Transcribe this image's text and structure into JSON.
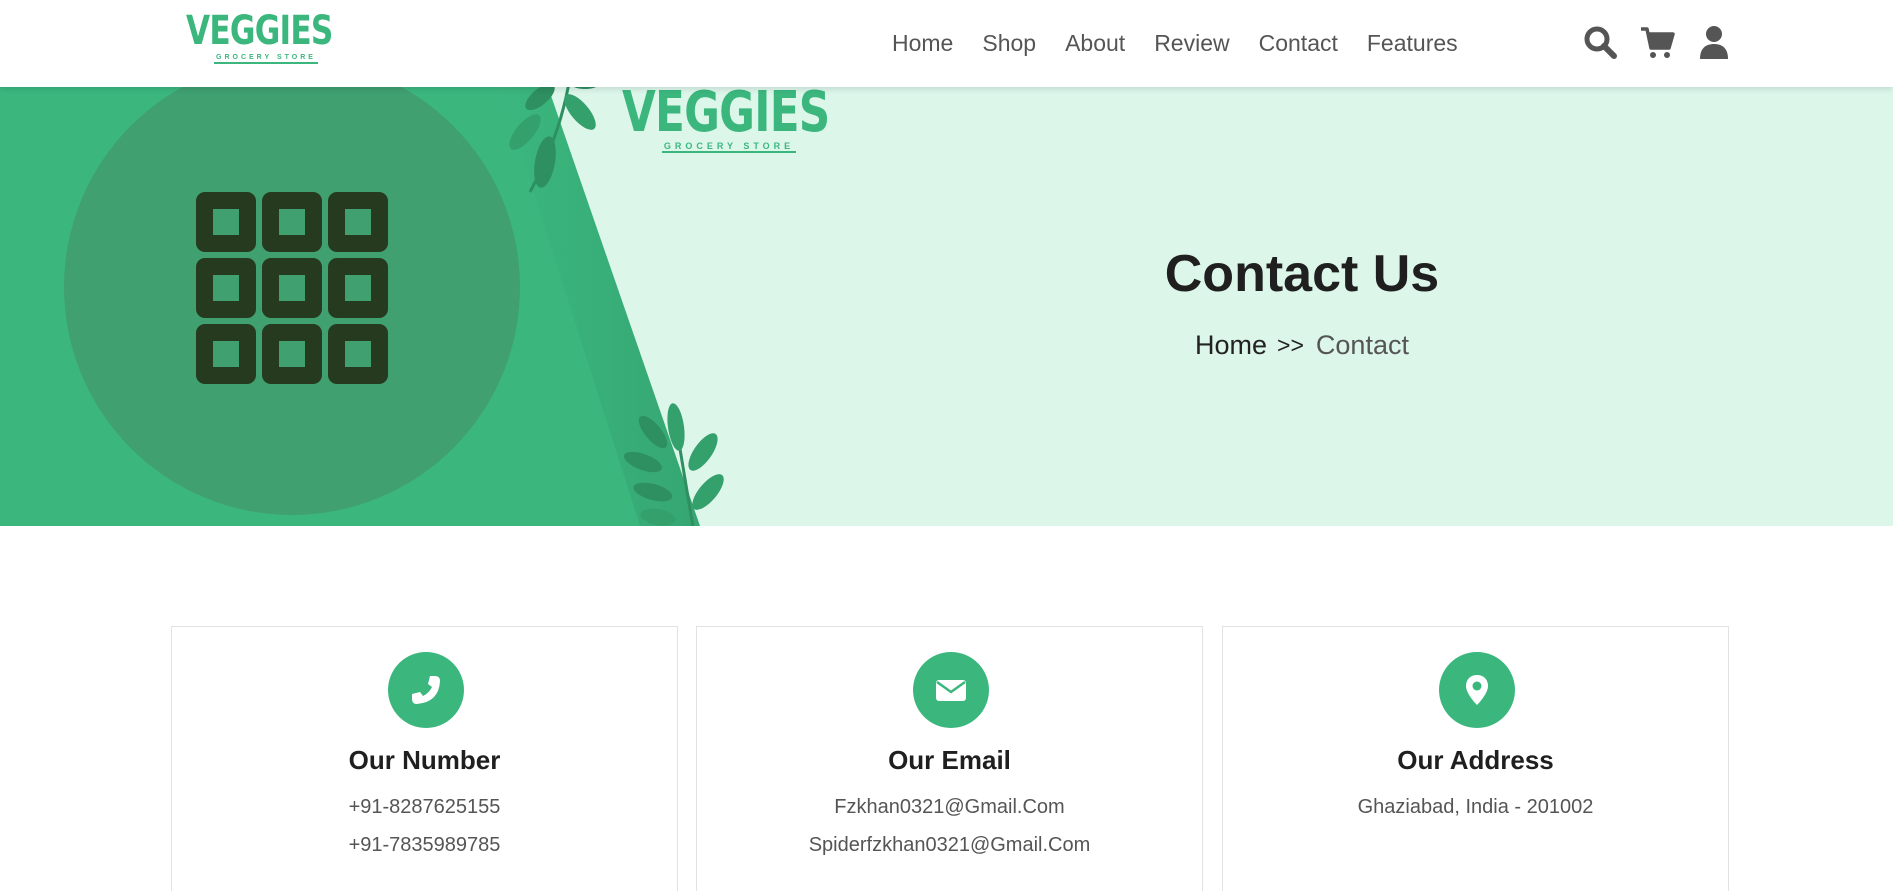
{
  "brand": {
    "name": "VEGGIES",
    "tagline": "GROCERY STORE",
    "accent_color": "#3bb77e",
    "banner_bg_color": "#dcf6ea"
  },
  "nav": {
    "items": [
      {
        "label": "Home"
      },
      {
        "label": "Shop"
      },
      {
        "label": "About"
      },
      {
        "label": "Review"
      },
      {
        "label": "Contact"
      },
      {
        "label": "Features"
      }
    ]
  },
  "header_icons": [
    "search-icon",
    "cart-icon",
    "user-icon"
  ],
  "banner": {
    "title": "Contact Us",
    "breadcrumb": {
      "home": "Home",
      "separator": ">>",
      "current": "Contact"
    },
    "illustration_icon": "grid-icon"
  },
  "contact_cards": [
    {
      "icon": "phone-icon",
      "title": "Our Number",
      "lines": [
        "+91-8287625155",
        "+91-7835989785"
      ]
    },
    {
      "icon": "envelope-icon",
      "title": "Our Email",
      "lines": [
        "Fzkhan0321@Gmail.Com",
        "Spiderfzkhan0321@Gmail.Com"
      ]
    },
    {
      "icon": "map-pin-icon",
      "title": "Our Address",
      "lines": [
        "Ghaziabad, India - 201002"
      ]
    }
  ]
}
